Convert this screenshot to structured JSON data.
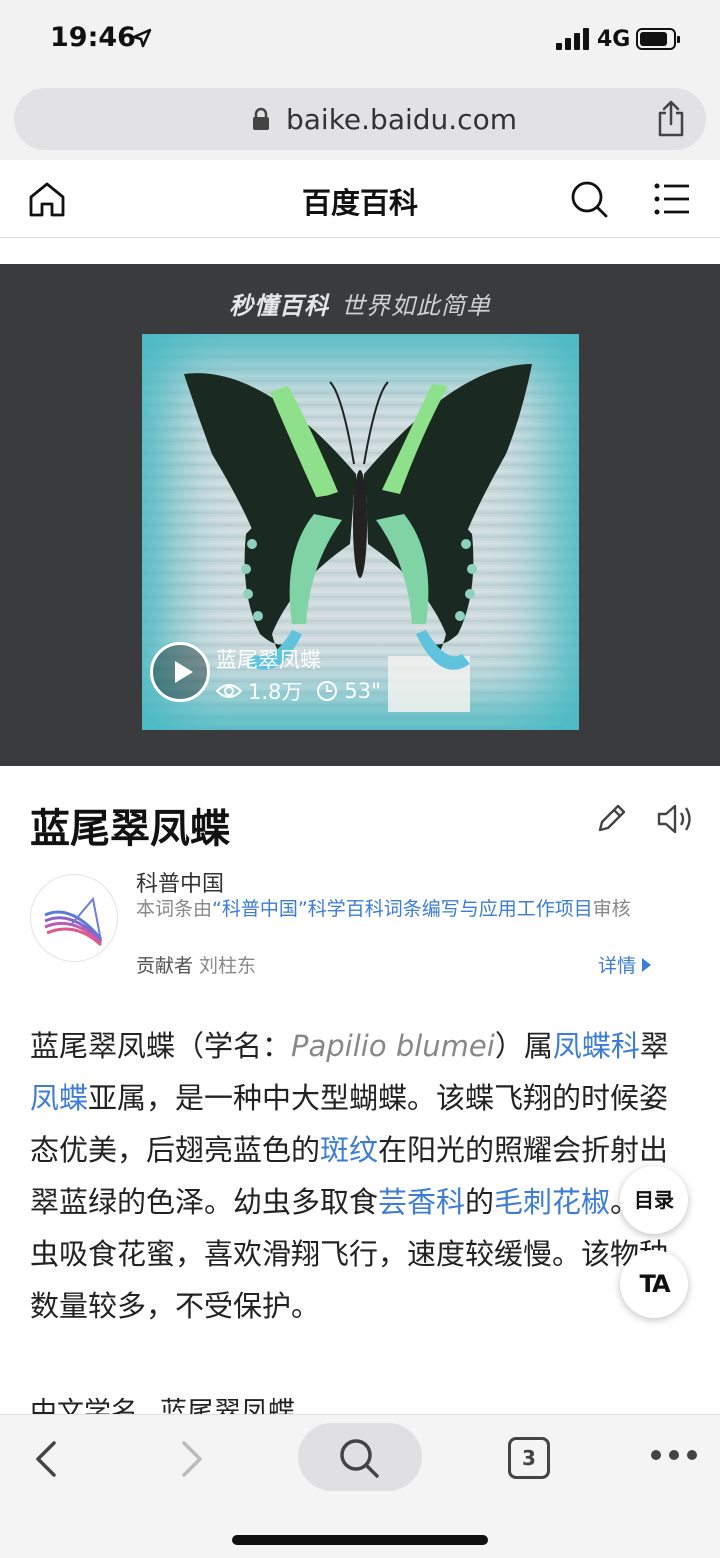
{
  "status_bar": {
    "time": "19:46",
    "network": "4G",
    "battery_level": 0.85
  },
  "browser": {
    "url": "baike.baidu.com"
  },
  "header": {
    "title": "百度百科"
  },
  "video": {
    "brand": "秒懂百科",
    "slogan": "世界如此简单",
    "title": "蓝尾翠凤蝶",
    "views": "1.8万",
    "duration": "53\""
  },
  "article": {
    "title": "蓝尾翠凤蝶",
    "source": {
      "name": "科普中国",
      "desc_prefix": "本词条由",
      "desc_link": "“科普中国”科学百科词条编写与应用工作项目",
      "desc_suffix": "审核",
      "contrib_label": "贡献者",
      "contrib_name": "刘柱东",
      "details": "详情"
    },
    "paragraph": {
      "t1": "蓝尾翠凤蝶（学名：",
      "sci": "Papilio blumei",
      "t2": "）属",
      "l1": "凤蝶科",
      "t3": "翠",
      "l2": "凤蝶",
      "t4": "亚属，是一种中大型蝴蝶。该蝶飞翔的时候姿态优美，后翅亮蓝色的",
      "l3": "斑纹",
      "t5": "在阳光的照耀会折射出翠蓝绿的色泽。幼虫多取食",
      "l4": "芸香科",
      "t6": "的",
      "l5": "毛刺花椒",
      "t7": "。成虫吸食花蜜，喜欢滑翔飞行，速度较缓慢。该物种数量较多，不受保护。"
    },
    "info": {
      "label": "中文学名",
      "value": "蓝尾翠凤蝶"
    }
  },
  "floating": {
    "toc": "目录",
    "font": "TA"
  },
  "toolbar": {
    "tabs_count": "3"
  },
  "colors": {
    "link": "#3d7dd8",
    "video_bg": "#3a3b3d"
  }
}
